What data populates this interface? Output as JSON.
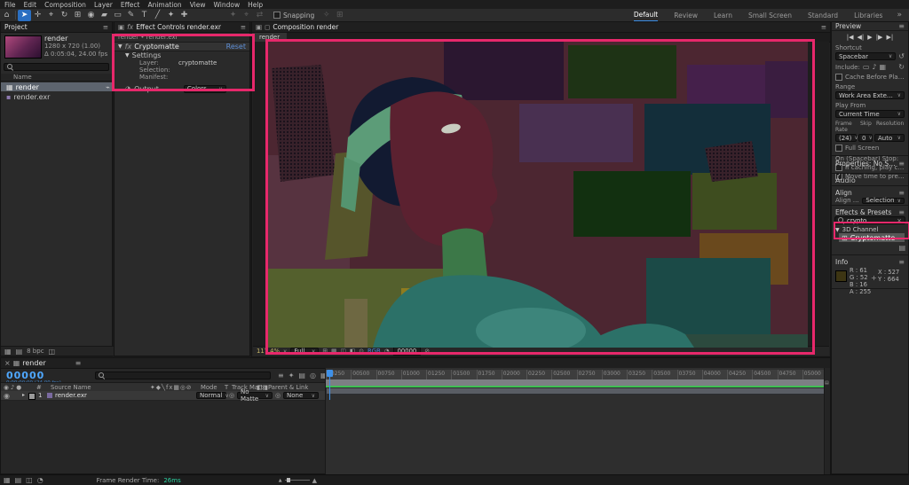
{
  "colors": {
    "accent_pink": "#e7286b",
    "accent_blue": "#3e90e8",
    "timecode_blue": "#4fa8ff",
    "cache_green": "#3fbf53",
    "render_time_green": "#2bd0a0",
    "info_swatch": "#3d3513"
  },
  "menu": {
    "items": [
      "File",
      "Edit",
      "Composition",
      "Layer",
      "Effect",
      "Animation",
      "View",
      "Window",
      "Help"
    ]
  },
  "toolbar": {
    "snapping": "Snapping"
  },
  "workspace": {
    "tabs": [
      "Default",
      "Review",
      "Learn",
      "Small Screen",
      "Standard",
      "Libraries"
    ],
    "overflow": "»"
  },
  "project": {
    "tab": "Project",
    "item_name": "render",
    "item_dim": "1280 x 720 (1.00)",
    "item_time": "Δ 0:05:04, 24.00 fps",
    "name_col": "Name",
    "rows": [
      {
        "name": "render"
      },
      {
        "name": "render.exr"
      }
    ],
    "footer_depth": "8 bpc"
  },
  "effect_controls": {
    "tab": "Effect Controls render.exr",
    "source": "render • render.exr",
    "effect_name": "Cryptomatte",
    "reset": "Reset",
    "settings": "Settings",
    "layer_label": "Layer:",
    "layer_value": "cryptomatte",
    "selection_label": "Selection:",
    "manifest_label": "Manifest:",
    "output_label": "Output",
    "output_value": "Colors"
  },
  "composition": {
    "tab": "Composition render",
    "viewer_tab": "render",
    "zoom": "117.4%",
    "resolution": "Full",
    "channel": "RGB",
    "timecode": "00000"
  },
  "preview": {
    "header": "Preview",
    "shortcut_label": "Shortcut",
    "shortcut_value": "Spacebar",
    "include_label": "Include:",
    "cache_label": "Cache Before Playback",
    "range_label": "Range",
    "range_value": "Work Area Extended By Current...",
    "playfrom_label": "Play From",
    "playfrom_value": "Current Time",
    "framerate_label": "Frame Rate",
    "skip_label": "Skip",
    "resolution_label": "Resolution",
    "framerate_value": "(24)",
    "skip_value": "0",
    "resolution_value": "Auto",
    "fullscreen_label": "Full Screen",
    "onstop_label": "On (Spacebar) Stop:",
    "caching_label": "If caching, play cached frames",
    "movetime_label": "Move time to preview time"
  },
  "properties": {
    "header": "Properties: No Selection"
  },
  "audio": {
    "header": "Audio"
  },
  "align": {
    "header": "Align",
    "row_label": "Align Layers to:",
    "row_value": "Selection"
  },
  "effects_presets": {
    "header": "Effects & Presets",
    "search_value": "crypto",
    "group": "3D Channel",
    "item": "Cryptomatte"
  },
  "info": {
    "header": "Info",
    "r": "R : 61",
    "g": "G : 52",
    "b": "B : 16",
    "a": "A : 255",
    "x": "X : 527",
    "y": "Y : 664"
  },
  "timeline": {
    "tab": "render",
    "timecode": "00000",
    "timecode_sub": "0;00;00;00 (24.00 fps)",
    "col_number": "#",
    "col_source": "Source Name",
    "col_mode": "Mode",
    "col_t": "T",
    "col_matte": "Track Matte",
    "col_parent": "Parent & Link",
    "layer_number": "1",
    "layer_name": "render.exr",
    "layer_mode": "Normal",
    "layer_matte": "No Matte",
    "layer_parent": "None",
    "ticks": [
      "00250",
      "00500",
      "00750",
      "01000",
      "01250",
      "01500",
      "01750",
      "02000",
      "02250",
      "02500",
      "02750",
      "03000",
      "03250",
      "03500",
      "03750",
      "04000",
      "04250",
      "04500",
      "04750",
      "05000"
    ]
  },
  "statusbar": {
    "label": "Frame Render Time:",
    "value": "26ms"
  }
}
